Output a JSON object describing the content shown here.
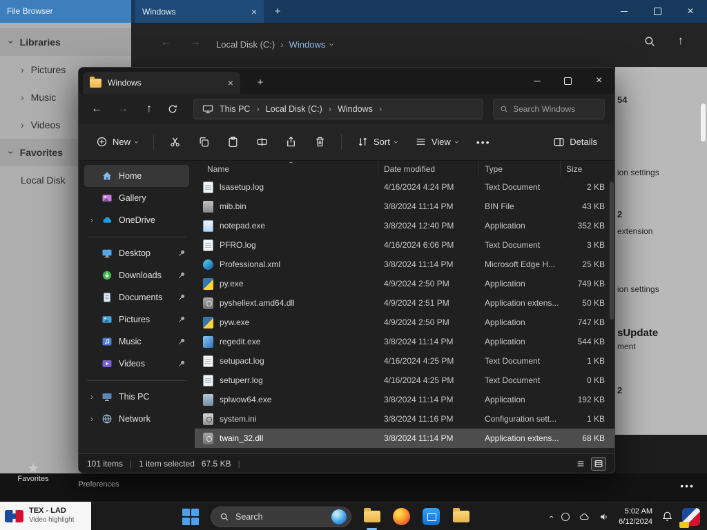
{
  "background_window": {
    "app_title": "File Browser",
    "tab_label": "Windows",
    "breadcrumb": {
      "drive": "Local Disk (C:)",
      "folder": "Windows"
    },
    "sidebar": [
      {
        "label": "Libraries"
      },
      {
        "label": "Pictures"
      },
      {
        "label": "Music"
      },
      {
        "label": "Videos"
      },
      {
        "label": "Favorites"
      },
      {
        "label": "Local Disk"
      }
    ],
    "right_edge_fragments": [
      "54",
      "ion settings",
      "2",
      "extension",
      "ion settings",
      "sUpdate",
      "ment",
      "2"
    ]
  },
  "explorer": {
    "tab_label": "Windows",
    "address": {
      "crumbs": [
        "This PC",
        "Local Disk (C:)",
        "Windows"
      ],
      "search_placeholder": "Search Windows"
    },
    "toolbar": {
      "new_label": "New",
      "sort_label": "Sort",
      "view_label": "View",
      "details_label": "Details"
    },
    "nav": [
      {
        "label": "Home",
        "icon": "home"
      },
      {
        "label": "Gallery",
        "icon": "gallery"
      },
      {
        "label": "OneDrive",
        "icon": "onedrive"
      },
      {
        "label": "Desktop",
        "icon": "desktop"
      },
      {
        "label": "Downloads",
        "icon": "downloads"
      },
      {
        "label": "Documents",
        "icon": "documents"
      },
      {
        "label": "Pictures",
        "icon": "pictures"
      },
      {
        "label": "Music",
        "icon": "music"
      },
      {
        "label": "Videos",
        "icon": "videos"
      },
      {
        "label": "This PC",
        "icon": "thispc"
      },
      {
        "label": "Network",
        "icon": "network"
      }
    ],
    "columns": {
      "name": "Name",
      "date": "Date modified",
      "type": "Type",
      "size": "Size"
    },
    "rows": [
      {
        "name": "lsasetup.log",
        "date": "4/16/2024 4:24 PM",
        "type": "Text Document",
        "size": "2 KB",
        "icon": "text"
      },
      {
        "name": "mib.bin",
        "date": "3/8/2024 11:14 PM",
        "type": "BIN File",
        "size": "43 KB",
        "icon": "bin"
      },
      {
        "name": "notepad.exe",
        "date": "3/8/2024 12:40 PM",
        "type": "Application",
        "size": "352 KB",
        "icon": "notepad"
      },
      {
        "name": "PFRO.log",
        "date": "4/16/2024 6:06 PM",
        "type": "Text Document",
        "size": "3 KB",
        "icon": "text"
      },
      {
        "name": "Professional.xml",
        "date": "3/8/2024 11:14 PM",
        "type": "Microsoft Edge H...",
        "size": "25 KB",
        "icon": "edge"
      },
      {
        "name": "py.exe",
        "date": "4/9/2024 2:50 PM",
        "type": "Application",
        "size": "749 KB",
        "icon": "python"
      },
      {
        "name": "pyshellext.amd64.dll",
        "date": "4/9/2024 2:51 PM",
        "type": "Application extens...",
        "size": "50 KB",
        "icon": "dll"
      },
      {
        "name": "pyw.exe",
        "date": "4/9/2024 2:50 PM",
        "type": "Application",
        "size": "747 KB",
        "icon": "python"
      },
      {
        "name": "regedit.exe",
        "date": "3/8/2024 11:14 PM",
        "type": "Application",
        "size": "544 KB",
        "icon": "regedit"
      },
      {
        "name": "setupact.log",
        "date": "4/16/2024 4:25 PM",
        "type": "Text Document",
        "size": "1 KB",
        "icon": "text"
      },
      {
        "name": "setuperr.log",
        "date": "4/16/2024 4:25 PM",
        "type": "Text Document",
        "size": "0 KB",
        "icon": "text"
      },
      {
        "name": "splwow64.exe",
        "date": "3/8/2024 11:14 PM",
        "type": "Application",
        "size": "192 KB",
        "icon": "app"
      },
      {
        "name": "system.ini",
        "date": "3/8/2024 11:16 PM",
        "type": "Configuration sett...",
        "size": "1 KB",
        "icon": "ini"
      },
      {
        "name": "twain_32.dll",
        "date": "3/8/2024 11:14 PM",
        "type": "Application extens...",
        "size": "68 KB",
        "icon": "dll"
      }
    ],
    "status": {
      "count": "101 items",
      "selection": "1 item selected",
      "selection_size": "67.5 KB"
    }
  },
  "desktop": {
    "icons": [
      {
        "label": "Favorites"
      },
      {
        "label": "Preferences"
      }
    ]
  },
  "overlay": {
    "title": "TEX - LAD",
    "subtitle": "Video highlight"
  },
  "taskbar": {
    "search_label": "Search",
    "clock": {
      "time": "5:02 AM",
      "date": "6/12/2024"
    }
  }
}
